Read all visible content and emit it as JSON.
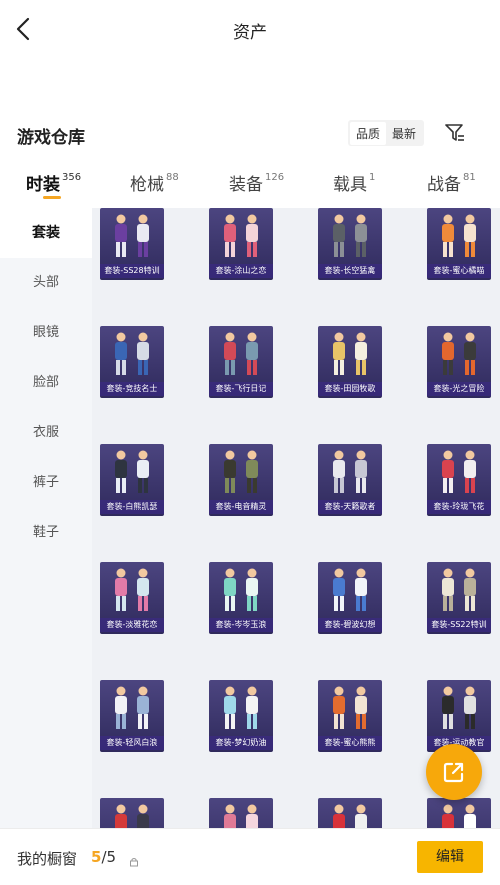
{
  "header": {
    "title": "资产",
    "back_icon": "back-arrow-icon"
  },
  "warehouse": {
    "title": "游戏仓库",
    "sort_options": [
      "品质",
      "最新"
    ],
    "active_sort": "品质",
    "filter_icon": "filter-icon"
  },
  "tabs": [
    {
      "label": "时装",
      "count": "356",
      "active": true
    },
    {
      "label": "枪械",
      "count": "88",
      "active": false
    },
    {
      "label": "装备",
      "count": "126",
      "active": false
    },
    {
      "label": "载具",
      "count": "1",
      "active": false
    },
    {
      "label": "战备",
      "count": "81",
      "active": false
    }
  ],
  "sidebar": {
    "items": [
      {
        "label": "套装",
        "active": true
      },
      {
        "label": "头部",
        "active": false
      },
      {
        "label": "眼镜",
        "active": false
      },
      {
        "label": "脸部",
        "active": false
      },
      {
        "label": "衣服",
        "active": false
      },
      {
        "label": "裤子",
        "active": false
      },
      {
        "label": "鞋子",
        "active": false
      }
    ]
  },
  "items": [
    {
      "label": "套装-SS28特训",
      "palette": [
        "#6b3fa0",
        "#e9e9f2"
      ]
    },
    {
      "label": "套装-涂山之恋",
      "palette": [
        "#e0607a",
        "#f3d3d8"
      ]
    },
    {
      "label": "套装-长空猛禽",
      "palette": [
        "#5b6066",
        "#8c9096"
      ]
    },
    {
      "label": "套装-蜜心橘喵",
      "palette": [
        "#f08a3a",
        "#f6e2cf"
      ]
    },
    {
      "label": "套装-竞技名士",
      "palette": [
        "#3a66b5",
        "#d6dbe6"
      ]
    },
    {
      "label": "套装-飞行日记",
      "palette": [
        "#d34a57",
        "#7a9ab0"
      ]
    },
    {
      "label": "套装-田园牧歌",
      "palette": [
        "#e8c468",
        "#f4efe0"
      ]
    },
    {
      "label": "套装-光之冒险",
      "palette": [
        "#e3672e",
        "#3b3b3b"
      ]
    },
    {
      "label": "套装-白熊凯瑟",
      "palette": [
        "#2e3440",
        "#e9eef5"
      ]
    },
    {
      "label": "套装-电音精灵",
      "palette": [
        "#3a3a30",
        "#7f8a5a"
      ]
    },
    {
      "label": "套装-天籁歌者",
      "palette": [
        "#e9e9ee",
        "#c7c7d4"
      ]
    },
    {
      "label": "套装-玲珑飞花",
      "palette": [
        "#d9434f",
        "#f2eef0"
      ]
    },
    {
      "label": "套装-淡雅花恋",
      "palette": [
        "#e27ba8",
        "#d4e6ef"
      ]
    },
    {
      "label": "套装-岑岑玉浪",
      "palette": [
        "#7fd6c4",
        "#eaf6f3"
      ]
    },
    {
      "label": "套装-碧波幻想",
      "palette": [
        "#4a7bd0",
        "#f1f4fa"
      ]
    },
    {
      "label": "套装-SS22特训",
      "palette": [
        "#ece6d6",
        "#b9b09a"
      ]
    },
    {
      "label": "套装-轻风白浪",
      "palette": [
        "#f1f1f6",
        "#9ab3d6"
      ]
    },
    {
      "label": "套装-梦幻奶油",
      "palette": [
        "#9fd9ea",
        "#f4f4f4"
      ]
    },
    {
      "label": "套装-蜜心熊熊",
      "palette": [
        "#e36c2f",
        "#f2e4d4"
      ]
    },
    {
      "label": "套装-运动教官",
      "palette": [
        "#2b2b2b",
        "#e0e0e0"
      ]
    },
    {
      "label": "",
      "palette": [
        "#d43a3a",
        "#3a3a4a"
      ]
    },
    {
      "label": "",
      "palette": [
        "#e07a96",
        "#f4d6de"
      ]
    },
    {
      "label": "",
      "palette": [
        "#d8323a",
        "#f0f0f0"
      ]
    },
    {
      "label": "",
      "palette": [
        "#d8323a",
        "#ffffff"
      ]
    }
  ],
  "fab": {
    "icon": "share-export-icon"
  },
  "showcase": {
    "label": "我的橱窗",
    "current": "5",
    "total": "5",
    "separator": "/"
  },
  "edit_button": {
    "label": "编辑"
  }
}
